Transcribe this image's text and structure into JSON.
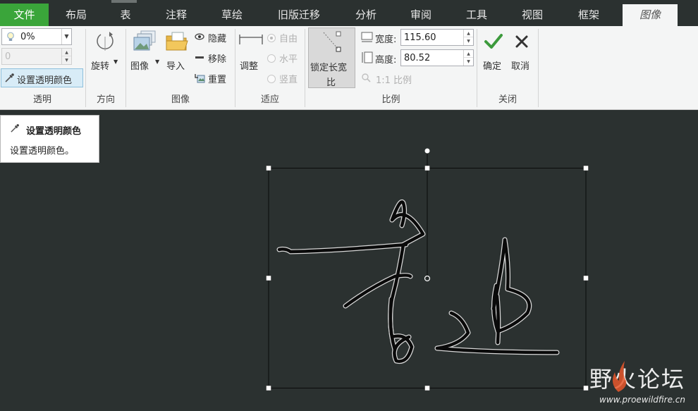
{
  "tabs": [
    {
      "label": "文件",
      "state": "file"
    },
    {
      "label": "布局"
    },
    {
      "label": "表"
    },
    {
      "label": "注释"
    },
    {
      "label": "草绘"
    },
    {
      "label": "旧版迁移"
    },
    {
      "label": "分析"
    },
    {
      "label": "审阅"
    },
    {
      "label": "工具"
    },
    {
      "label": "视图"
    },
    {
      "label": "框架"
    },
    {
      "label": "图像",
      "state": "active"
    }
  ],
  "groups": {
    "transparency": {
      "label": "透明",
      "percent_value": "0%",
      "second_value": "0",
      "set_color_label": "设置透明颜色"
    },
    "direction": {
      "label": "方向",
      "rotate_label": "旋转"
    },
    "image": {
      "label": "图像",
      "image_label": "图像",
      "import_label": "导入",
      "hide_label": "隐藏",
      "remove_label": "移除",
      "reset_label": "重置"
    },
    "fit": {
      "label": "适应",
      "adjust_label": "调整",
      "free_label": "自由",
      "horizontal_label": "水平",
      "vertical_label": "竖直"
    },
    "scale": {
      "label": "比例",
      "lock_ratio_line1": "锁定长宽",
      "lock_ratio_line2": "比",
      "width_label": "宽度:",
      "width_value": "115.60",
      "height_label": "高度:",
      "height_value": "80.52",
      "one_to_one_label": "1:1 比例"
    },
    "close": {
      "label": "关闭",
      "ok_label": "确定",
      "cancel_label": "取消"
    }
  },
  "tooltip": {
    "title": "设置透明颜色",
    "description": "设置透明颜色。"
  },
  "watermark": {
    "name": "野火论坛",
    "url": "www.proewildfire.cn"
  },
  "colors": {
    "file_tab": "#3aa53a",
    "canvas_bg": "#2b3130",
    "ribbon_bg": "#f4f5f5",
    "check_green": "#3c9a3c",
    "watermark_flame": "#e8572b"
  }
}
